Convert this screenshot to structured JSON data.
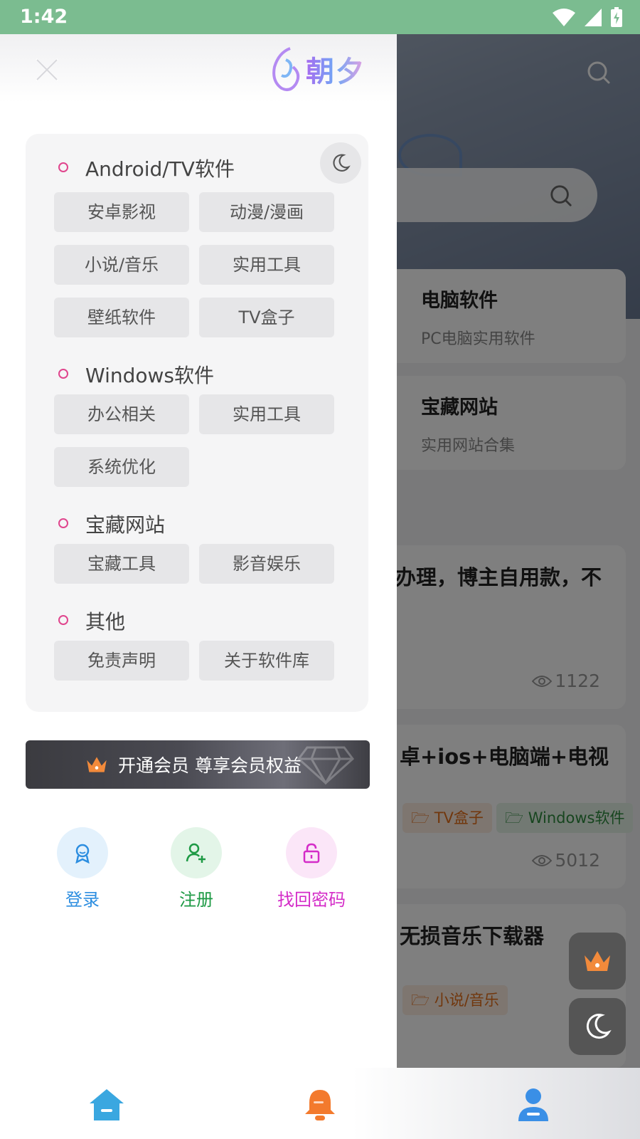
{
  "status_bar": {
    "time": "1:42"
  },
  "drawer": {
    "logo_text": "朝夕",
    "sections": [
      {
        "label": "Android/TV软件",
        "items": [
          "安卓影视",
          "动漫/漫画",
          "小说/音乐",
          "实用工具",
          "壁纸软件",
          "TV盒子"
        ]
      },
      {
        "label": "Windows软件",
        "items": [
          "办公相关",
          "实用工具",
          "系统优化"
        ]
      },
      {
        "label": "宝藏网站",
        "items": [
          "宝藏工具",
          "影音娱乐"
        ]
      },
      {
        "label": "其他",
        "items": [
          "免责声明",
          "关于软件库"
        ]
      }
    ],
    "vip_banner": "开通会员 尊享会员权益",
    "actions": [
      {
        "label": "登录",
        "color": "#2d8ee0",
        "bg": "#e3f1fc"
      },
      {
        "label": "注册",
        "color": "#1e9a45",
        "bg": "#e3f5e8"
      },
      {
        "label": "找回密码",
        "color": "#d42cc8",
        "bg": "#fbe6f8"
      }
    ]
  },
  "background_page": {
    "cards": [
      {
        "title": "电脑软件",
        "subtitle": "PC电脑实用软件"
      },
      {
        "title": "宝藏网站",
        "subtitle": "实用网站合集"
      }
    ],
    "posts": [
      {
        "title": "办理，博主自用款，不",
        "views": "1122",
        "tags": []
      },
      {
        "title": "卓+ios+电脑端+电视",
        "views": "5012",
        "tags": [
          "TV盒子",
          "Windows软件"
        ]
      },
      {
        "title": "无损音乐下载器",
        "views": "",
        "tags": [
          "小说/音乐"
        ]
      }
    ]
  },
  "colors": {
    "status_bar": "#7bbc90",
    "accent_pink": "#e0458d",
    "home_icon": "#3aa7e0",
    "bell_icon": "#f37a2d",
    "user_icon": "#3a8fe6",
    "crown": "#f28a3b"
  },
  "icons": {
    "close": "close-icon",
    "search": "search-icon",
    "moon": "moon-icon",
    "crown": "crown-icon",
    "login": "badge-icon",
    "register": "user-plus-icon",
    "recover": "lock-icon",
    "home": "home-icon",
    "bell": "bell-icon",
    "user": "user-icon"
  }
}
